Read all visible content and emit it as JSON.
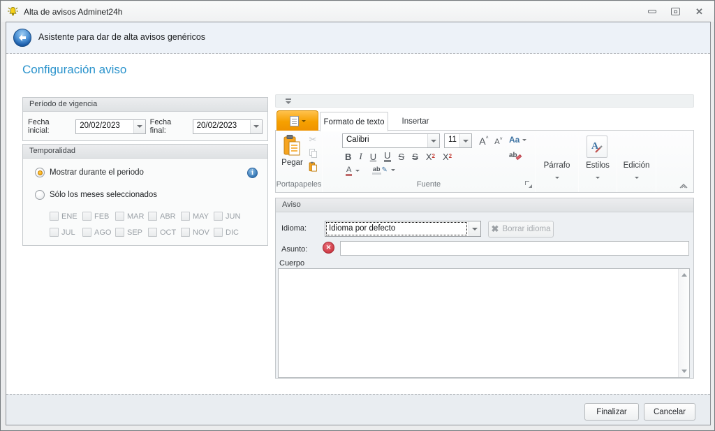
{
  "window": {
    "title": "Alta de avisos Adminet24h"
  },
  "header": {
    "title": "Asistente para dar de alta avisos genéricos"
  },
  "page": {
    "title": "Configuración aviso"
  },
  "periodo": {
    "title": "Período de vigencia",
    "fecha_inicial": {
      "label": "Fecha inicial:",
      "value": "20/02/2023"
    },
    "fecha_final": {
      "label": "Fecha final:",
      "value": "20/02/2023"
    }
  },
  "temporalidad": {
    "title": "Temporalidad",
    "options": [
      {
        "label": "Mostrar durante el periodo",
        "selected": true
      },
      {
        "label": "Sólo los meses seleccionados",
        "selected": false
      }
    ],
    "months_row1": [
      "ENE",
      "FEB",
      "MAR",
      "ABR",
      "MAY",
      "JUN"
    ],
    "months_row2": [
      "JUL",
      "AGO",
      "SEP",
      "OCT",
      "NOV",
      "DIC"
    ]
  },
  "ribbon": {
    "tabs": [
      {
        "label": "Formato de texto"
      },
      {
        "label": "Insertar"
      }
    ],
    "paste": "Pegar",
    "font_name": "Calibri",
    "font_size": "11",
    "groups": {
      "clipboard": "Portapapeles",
      "font": "Fuente",
      "paragraph": "Párrafo",
      "styles": "Estilos",
      "editing": "Edición"
    },
    "format": {
      "bold": "B",
      "italic": "I",
      "underline": "U",
      "double_underline": "U",
      "strikethrough": "S",
      "double_strikethrough": "S",
      "script_base": "X",
      "sup_mark": "2",
      "sub_mark": "2",
      "grow_font": "A",
      "shrink_font": "A",
      "change_case": "Aa",
      "font_color": "A",
      "highlight": "ab",
      "clear_formatting": "ab",
      "styles_icon_letter": "A"
    }
  },
  "aviso": {
    "title": "Aviso",
    "idioma": {
      "label": "Idioma:",
      "value": "Idioma por defecto"
    },
    "borrar_idioma": "Borrar idioma",
    "asunto": {
      "label": "Asunto:",
      "value": ""
    },
    "cuerpo": {
      "label": "Cuerpo",
      "value": ""
    }
  },
  "footer": {
    "finalizar": "Finalizar",
    "cancelar": "Cancelar"
  },
  "colors": {
    "accent_blue": "#2a93cc",
    "app_orange": "#f6a000",
    "error_red": "#cf3c46",
    "info_blue": "#3779b5",
    "radio_selected": "#f39c00"
  }
}
